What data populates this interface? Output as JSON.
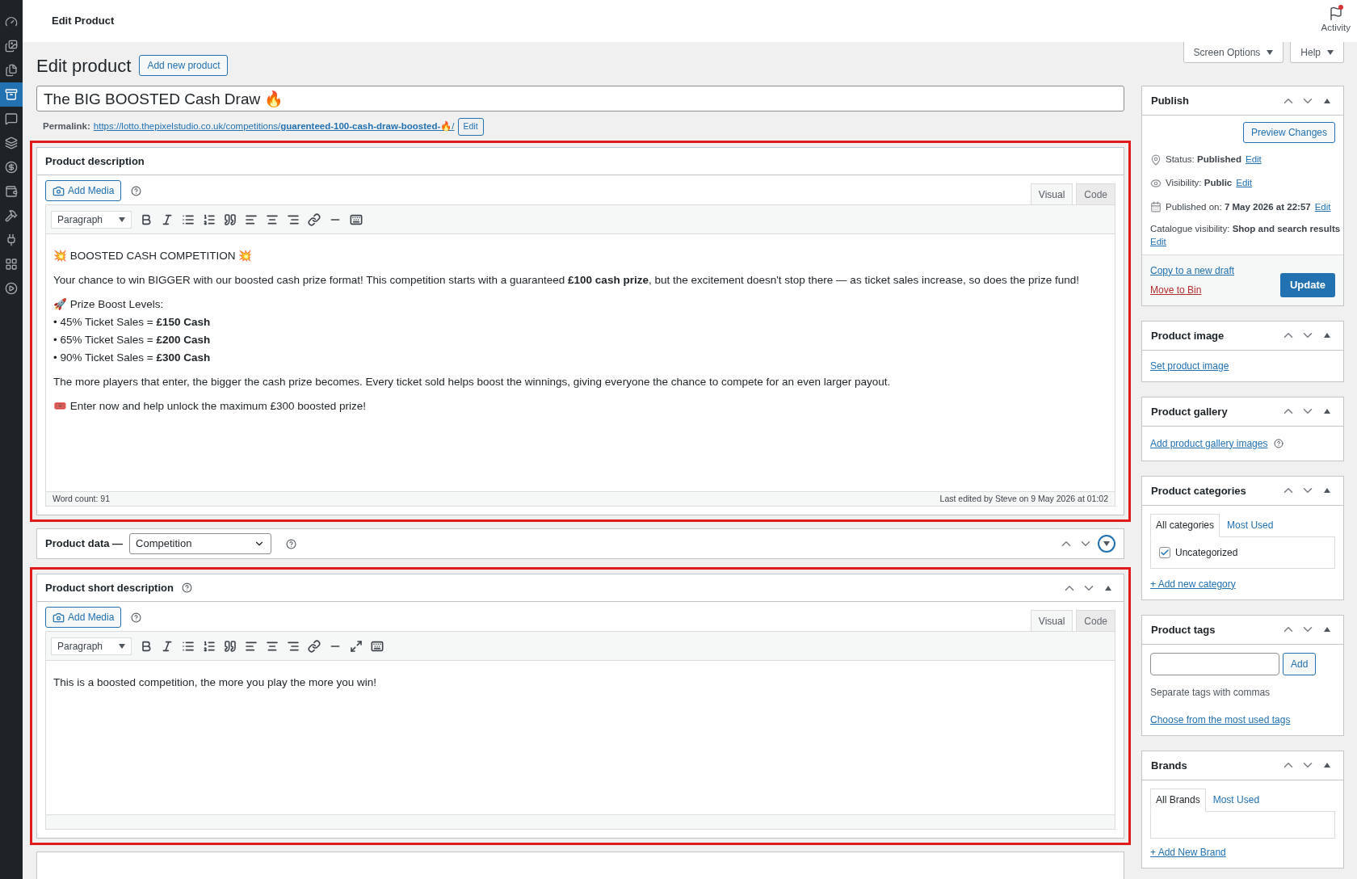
{
  "admin_menu": [
    {
      "kind": "dashboard",
      "selected": false
    },
    {
      "kind": "media",
      "selected": false
    },
    {
      "kind": "pages",
      "selected": false
    },
    {
      "kind": "products",
      "selected": true
    },
    {
      "kind": "woo",
      "selected": false
    },
    {
      "kind": "stack",
      "selected": false
    },
    {
      "kind": "dollar",
      "selected": false
    },
    {
      "kind": "wallet",
      "selected": false
    },
    {
      "kind": "hammer",
      "selected": false
    },
    {
      "kind": "plugin",
      "selected": false
    },
    {
      "kind": "block",
      "selected": false
    },
    {
      "kind": "play",
      "selected": false
    }
  ],
  "top_bar": {
    "title": "Edit Product",
    "activity": "Activity"
  },
  "screen_buttons": [
    "Screen Options",
    "Help"
  ],
  "heading": "Edit product",
  "add_new": "Add new product",
  "title_field": {
    "value": "The BIG BOOSTED Cash Draw 🔥"
  },
  "permalink": {
    "label": "Permalink:",
    "url_base": "https://lotto.thepixelstudio.co.uk/competitions/",
    "slug": "guarenteed-100-cash-draw-boosted-🔥",
    "trail": "/",
    "edit": "Edit"
  },
  "description_panel": {
    "title": "Product description",
    "add_media": "Add Media",
    "tabs": [
      {
        "label": "Visual",
        "selected": true
      },
      {
        "label": "Code",
        "selected": false
      }
    ],
    "format": "Paragraph",
    "content": [
      {
        "kind": "paragraph",
        "text": "💥 BOOSTED CASH COMPETITION 💥"
      },
      {
        "kind": "paragraph",
        "text": "Your chance to win BIGGER with our boosted cash prize format! This competition starts with a guaranteed **£100 cash prize**, but the excitement doesn't stop there — as ticket sales increase, so does the prize fund!"
      },
      {
        "kind": "lines",
        "lines": [
          "🚀 Prize Boost Levels:",
          "• 45% Ticket Sales = **£150 Cash**",
          "• 65% Ticket Sales = **£200 Cash**",
          "• 90% Ticket Sales = **£300 Cash**"
        ]
      },
      {
        "kind": "paragraph",
        "text": "The more players that enter, the bigger the cash prize becomes. Every ticket sold helps boost the winnings, giving everyone the chance to compete for an even larger payout."
      },
      {
        "kind": "paragraph",
        "text": "🎟️ Enter now and help unlock the maximum £300 boosted prize!"
      }
    ],
    "word_count": "Word count: 91",
    "last_edited": "Last edited by Steve on 9 May 2026 at 01:02"
  },
  "product_data": {
    "label": "Product data —",
    "type": "Competition"
  },
  "short_description": {
    "title": "Product short description",
    "add_media": "Add Media",
    "tabs": [
      {
        "label": "Visual",
        "selected": true
      },
      {
        "label": "Code",
        "selected": false
      }
    ],
    "format": "Paragraph",
    "content": [
      {
        "kind": "paragraph",
        "text": "This is a boosted competition, the more you play the more you win!"
      }
    ]
  },
  "publish": {
    "title": "Publish",
    "preview": "Preview Changes",
    "rows": [
      {
        "kind": "status",
        "label": "Status:",
        "value": "Published",
        "edit": "Edit"
      },
      {
        "kind": "visibility",
        "label": "Visibility:",
        "value": "Public",
        "edit": "Edit"
      },
      {
        "kind": "date",
        "label": "Published on:",
        "value": "7 May 2026 at 22:57",
        "edit": "Edit"
      }
    ],
    "catalogue": {
      "label": "Catalogue visibility:",
      "value": "Shop and search results",
      "edit": "Edit"
    },
    "copy": "Copy to a new draft",
    "bin": "Move to Bin",
    "update": "Update"
  },
  "product_image": {
    "title": "Product image",
    "link": "Set product image"
  },
  "product_gallery": {
    "title": "Product gallery",
    "link": "Add product gallery images"
  },
  "categories": {
    "title": "Product categories",
    "tabs": [
      {
        "label": "All categories",
        "selected": true
      },
      {
        "label": "Most Used",
        "selected": false
      }
    ],
    "items": [
      {
        "label": "Uncategorized",
        "checked": true
      }
    ],
    "add": "+ Add new category"
  },
  "tags": {
    "title": "Product tags",
    "button": "Add",
    "hint": "Separate tags with commas",
    "link": "Choose from the most used tags"
  },
  "brands": {
    "title": "Brands",
    "tabs": [
      {
        "label": "All Brands",
        "selected": true
      },
      {
        "label": "Most Used",
        "selected": false
      }
    ],
    "add": "+ Add New Brand"
  }
}
